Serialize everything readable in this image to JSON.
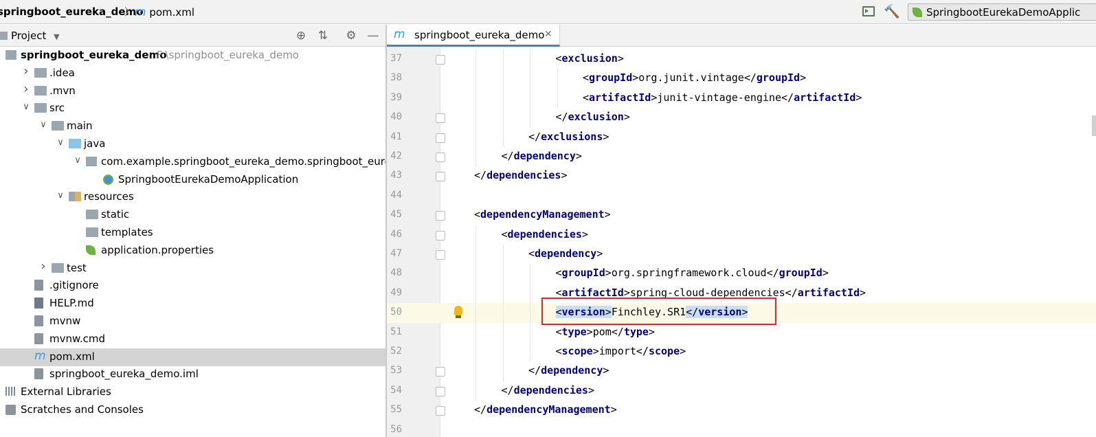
{
  "navbar": {
    "project_crumb": "springboot_eureka_demo",
    "file_crumb": "pom.xml",
    "separator": "〉",
    "run_config": "SpringbootEurekaDemoApplic"
  },
  "project_panel": {
    "title": "Project",
    "tree": [
      {
        "label": "springboot_eureka_demo",
        "path": "F:\\springboot_eureka_demo",
        "depth": 0,
        "kind": "module",
        "expanded": true
      },
      {
        "label": ".idea",
        "depth": 1,
        "kind": "folder",
        "expanded": false
      },
      {
        "label": ".mvn",
        "depth": 1,
        "kind": "folder",
        "expanded": false
      },
      {
        "label": "src",
        "depth": 1,
        "kind": "folder",
        "expanded": true
      },
      {
        "label": "main",
        "depth": 2,
        "kind": "folder",
        "expanded": true
      },
      {
        "label": "java",
        "depth": 3,
        "kind": "source-folder",
        "expanded": true
      },
      {
        "label": "com.example.springboot_eureka_demo.springboot_eureka_",
        "depth": 4,
        "kind": "package",
        "expanded": true
      },
      {
        "label": "SpringbootEurekaDemoApplication",
        "depth": 5,
        "kind": "spring-class"
      },
      {
        "label": "resources",
        "depth": 3,
        "kind": "resources-folder",
        "expanded": true
      },
      {
        "label": "static",
        "depth": 4,
        "kind": "folder"
      },
      {
        "label": "templates",
        "depth": 4,
        "kind": "folder"
      },
      {
        "label": "application.properties",
        "depth": 4,
        "kind": "spring-properties"
      },
      {
        "label": "test",
        "depth": 2,
        "kind": "folder",
        "expanded": false
      },
      {
        "label": ".gitignore",
        "depth": 1,
        "kind": "file"
      },
      {
        "label": "HELP.md",
        "depth": 1,
        "kind": "markdown"
      },
      {
        "label": "mvnw",
        "depth": 1,
        "kind": "file"
      },
      {
        "label": "mvnw.cmd",
        "depth": 1,
        "kind": "file"
      },
      {
        "label": "pom.xml",
        "depth": 1,
        "kind": "maven",
        "selected": true
      },
      {
        "label": "springboot_eureka_demo.iml",
        "depth": 1,
        "kind": "iml"
      },
      {
        "label": "External Libraries",
        "depth": 0,
        "kind": "libraries"
      },
      {
        "label": "Scratches and Consoles",
        "depth": 0,
        "kind": "scratches"
      }
    ]
  },
  "editor": {
    "tab_label": "springboot_eureka_demo",
    "current_line": 50,
    "lines": [
      {
        "n": "37",
        "indent": 3,
        "open": "exclusion",
        "close": "",
        "text": "",
        "fold": true
      },
      {
        "n": "38",
        "indent": 4,
        "open": "groupId",
        "text": "org.junit.vintage",
        "close": "groupId"
      },
      {
        "n": "39",
        "indent": 4,
        "open": "artifactId",
        "text": "junit-vintage-engine",
        "close": "artifactId"
      },
      {
        "n": "40",
        "indent": 3,
        "open": "",
        "text": "",
        "close": "exclusion",
        "fold": true
      },
      {
        "n": "41",
        "indent": 2,
        "open": "",
        "text": "",
        "close": "exclusions",
        "fold": true
      },
      {
        "n": "42",
        "indent": 1,
        "open": "",
        "text": "",
        "close": "dependency",
        "fold": true
      },
      {
        "n": "43",
        "indent": 0,
        "open": "",
        "text": "",
        "close": "dependencies",
        "fold": true
      },
      {
        "n": "44",
        "indent": 0,
        "open": "",
        "text": "",
        "close": ""
      },
      {
        "n": "45",
        "indent": 0,
        "open": "dependencyManagement",
        "text": "",
        "close": "",
        "fold": true
      },
      {
        "n": "46",
        "indent": 1,
        "open": "dependencies",
        "text": "",
        "close": "",
        "fold": true
      },
      {
        "n": "47",
        "indent": 2,
        "open": "dependency",
        "text": "",
        "close": "",
        "fold": true
      },
      {
        "n": "48",
        "indent": 3,
        "open": "groupId",
        "text": "org.springframework.cloud",
        "close": "groupId"
      },
      {
        "n": "49",
        "indent": 3,
        "open": "artifactId",
        "text": "spring-cloud-dependencies",
        "close": "artifactId"
      },
      {
        "n": "50",
        "indent": 3,
        "open": "version",
        "text": "Finchley.SR1",
        "close": "version",
        "highlight": true
      },
      {
        "n": "51",
        "indent": 3,
        "open": "type",
        "text": "pom",
        "close": "type"
      },
      {
        "n": "52",
        "indent": 3,
        "open": "scope",
        "text": "import",
        "close": "scope"
      },
      {
        "n": "53",
        "indent": 2,
        "open": "",
        "text": "",
        "close": "dependency",
        "fold": true
      },
      {
        "n": "54",
        "indent": 1,
        "open": "",
        "text": "",
        "close": "dependencies",
        "fold": true
      },
      {
        "n": "55",
        "indent": 0,
        "open": "",
        "text": "",
        "close": "dependencyManagement",
        "fold": true
      },
      {
        "n": "56",
        "indent": 0,
        "open": "",
        "text": "",
        "close": ""
      }
    ]
  },
  "colors": {
    "tag": "#000080",
    "selection": "#c7dff9",
    "current_line": "#fcfae6",
    "red_box": "#e0262b",
    "tab_underline": "#4083c9"
  }
}
